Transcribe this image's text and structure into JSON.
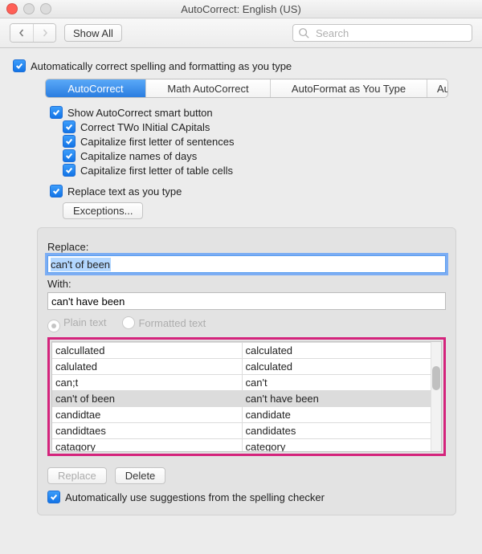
{
  "title": "AutoCorrect: English (US)",
  "toolbar": {
    "show_all": "Show All",
    "search_placeholder": "Search"
  },
  "options": {
    "auto_correct_typing": "Automatically correct spelling and formatting as you type",
    "show_smart_button": "Show AutoCorrect smart button",
    "two_initial_caps": "Correct TWo INitial CApitals",
    "first_letter_sentences": "Capitalize first letter of sentences",
    "names_of_days": "Capitalize names of days",
    "first_letter_table": "Capitalize first letter of table cells",
    "replace_as_type": "Replace text as you type",
    "auto_suggest": "Automatically use suggestions from the spelling checker"
  },
  "tabs": {
    "autocorrect": "AutoCorrect",
    "math": "Math AutoCorrect",
    "autoformat": "AutoFormat as You Type",
    "autotext": "AutoText"
  },
  "buttons": {
    "exceptions": "Exceptions...",
    "replace": "Replace",
    "delete": "Delete"
  },
  "panel": {
    "replace_label": "Replace:",
    "with_label": "With:",
    "replace_value": "can't of been",
    "with_value": "can't have been",
    "plain_text": "Plain text",
    "formatted_text": "Formatted text"
  },
  "list": {
    "rows": [
      {
        "from": "calcullated",
        "to": "calculated",
        "sel": false
      },
      {
        "from": "calulated",
        "to": "calculated",
        "sel": false
      },
      {
        "from": "can;t",
        "to": "can't",
        "sel": false
      },
      {
        "from": "can't of been",
        "to": "can't have been",
        "sel": true
      },
      {
        "from": "candidtae",
        "to": "candidate",
        "sel": false
      },
      {
        "from": "candidtaes",
        "to": "candidates",
        "sel": false
      },
      {
        "from": "catagory",
        "to": "category",
        "sel": false
      }
    ]
  }
}
